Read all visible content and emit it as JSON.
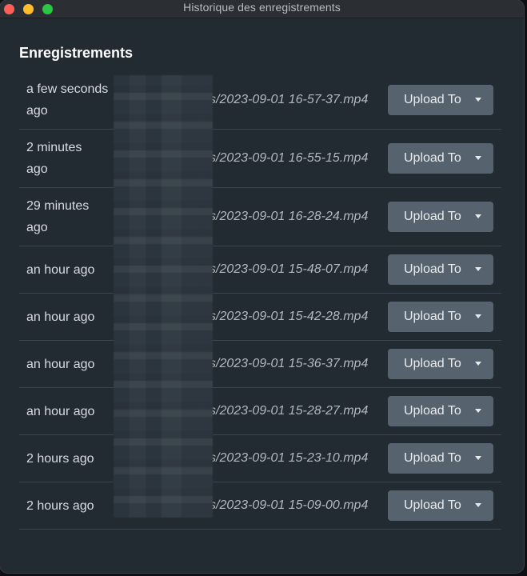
{
  "window": {
    "title": "Historique des enregistrements"
  },
  "heading": "Enregistrements",
  "rows": [
    {
      "time_line1": "a few seconds",
      "time_line2": "ago",
      "path": "s/2023-09-01 16-57-37.mp4",
      "button": "Upload To"
    },
    {
      "time_line1": "2 minutes",
      "time_line2": "ago",
      "path": "s/2023-09-01 16-55-15.mp4",
      "button": "Upload To"
    },
    {
      "time_line1": "29 minutes",
      "time_line2": "ago",
      "path": "s/2023-09-01 16-28-24.mp4",
      "button": "Upload To"
    },
    {
      "time": "an hour ago",
      "path": "s/2023-09-01 15-48-07.mp4",
      "button": "Upload To"
    },
    {
      "time": "an hour ago",
      "path": "s/2023-09-01 15-42-28.mp4",
      "button": "Upload To"
    },
    {
      "time": "an hour ago",
      "path": "s/2023-09-01 15-36-37.mp4",
      "button": "Upload To"
    },
    {
      "time": "an hour ago",
      "path": "s/2023-09-01 15-28-27.mp4",
      "button": "Upload To"
    },
    {
      "time": "2 hours ago",
      "path": "s/2023-09-01 15-23-10.mp4",
      "button": "Upload To"
    },
    {
      "time": "2 hours ago",
      "path": "s/2023-09-01 15-09-00.mp4",
      "button": "Upload To"
    }
  ],
  "icons": {
    "close": "close-dot-icon",
    "minimize": "minimize-dot-icon",
    "maximize": "maximize-dot-icon",
    "caret": "caret-down-icon"
  },
  "colors": {
    "background": "#222a32",
    "button": "#56636f",
    "close": "#fe5f57",
    "minimize": "#febc2e",
    "maximize": "#28c840"
  }
}
